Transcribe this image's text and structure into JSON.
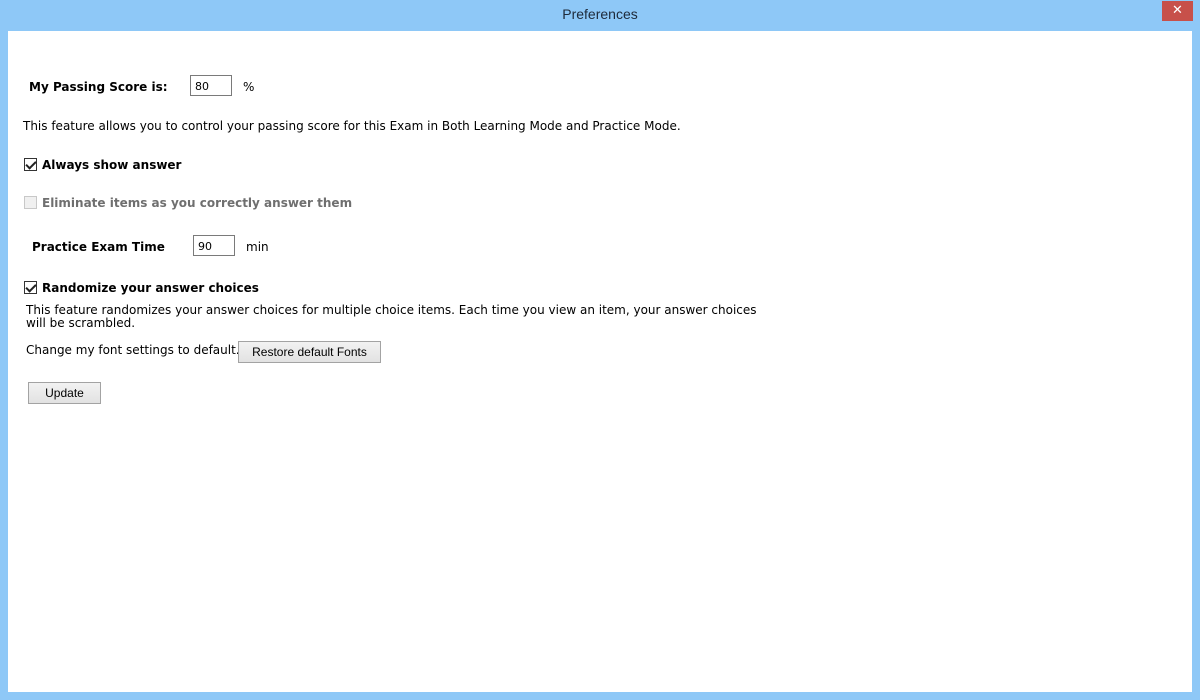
{
  "window": {
    "title": "Preferences",
    "close_glyph": "✕"
  },
  "passing_score": {
    "label": "My Passing Score is:",
    "value": "80",
    "unit": "%",
    "description": "This feature allows you to control your passing score for this Exam in Both Learning Mode and Practice Mode."
  },
  "always_show_answer": {
    "label": "Always show answer",
    "checked": true
  },
  "eliminate_items": {
    "label": "Eliminate items as you correctly answer them",
    "checked": false,
    "enabled": false
  },
  "practice_exam_time": {
    "label": "Practice Exam Time",
    "value": "90",
    "unit": "min"
  },
  "randomize": {
    "label": "Randomize your answer choices",
    "checked": true,
    "description_line1": "This feature randomizes your answer choices for multiple choice items. Each time you view an item, your answer choices",
    "description_line2": "will be scrambled."
  },
  "fonts": {
    "label": "Change my font settings to default.",
    "button_label": "Restore default Fonts"
  },
  "update_button_label": "Update",
  "colors": {
    "titlebar": "#8ec8f7",
    "close_button": "#c7504a"
  },
  "icons": {
    "close": "close-icon"
  }
}
